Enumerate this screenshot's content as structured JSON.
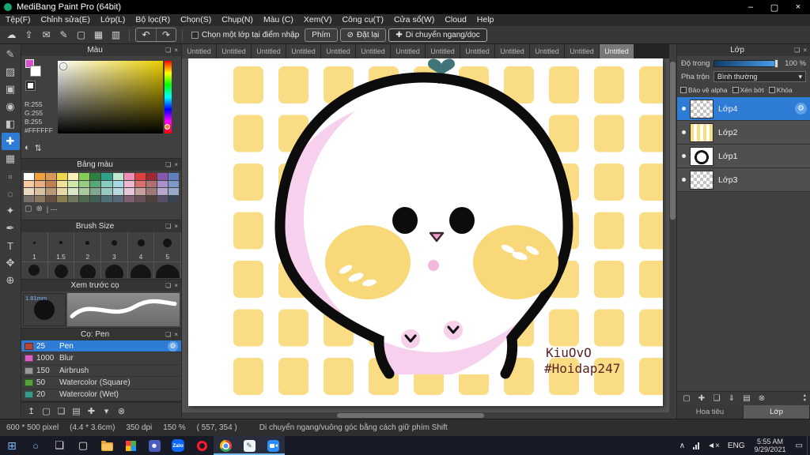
{
  "colors": {
    "accent_blue": "#2e7cd6",
    "canvas_yellow": "#f9dc83",
    "body_pink": "#f6d0ec",
    "sprout_teal": "#3f7478",
    "signature_red": "#5b2222"
  },
  "titlebar": {
    "title": "MediBang Paint Pro (64bit)",
    "minimize_glyph": "–",
    "maximize_glyph": "▢",
    "close_glyph": "×"
  },
  "menubar": {
    "items": [
      "Tệp(F)",
      "Chỉnh sửa(E)",
      "Lớp(L)",
      "Bộ lọc(R)",
      "Chọn(S)",
      "Chụp(N)",
      "Màu (C)",
      "Xem(V)",
      "Công cụ(T)",
      "Cửa sổ(W)",
      "Cloud",
      "Help"
    ]
  },
  "toolbar": {
    "icons": {
      "cloud": "☁",
      "upload": "⇧",
      "comment": "✉",
      "edit": "✎",
      "document": "▢",
      "grid": "▦",
      "table": "▥",
      "undo": "↶",
      "redo": "↷",
      "reset": "⊘",
      "move": "✚"
    },
    "select_layer_label": "Chọn một lớp tại điểm nhập",
    "key_button": "Phím",
    "reset_button": "Đặt lại",
    "move_button": "Di chuyển ngang/dọc"
  },
  "tabs": [
    {
      "label": "Untitled"
    },
    {
      "label": "Untitled"
    },
    {
      "label": "Untitled"
    },
    {
      "label": "Untitled"
    },
    {
      "label": "Untitled"
    },
    {
      "label": "Untitled"
    },
    {
      "label": "Untitled"
    },
    {
      "label": "Untitled"
    },
    {
      "label": "Untitled"
    },
    {
      "label": "Untitled"
    },
    {
      "label": "Untitled"
    },
    {
      "label": "Untitled"
    },
    {
      "label": "Untitled",
      "active": true
    }
  ],
  "tools": [
    {
      "glyph": "✎"
    },
    {
      "glyph": "▨"
    },
    {
      "glyph": "▣"
    },
    {
      "glyph": "◉"
    },
    {
      "glyph": "◧"
    },
    {
      "glyph": "✚",
      "active": true
    },
    {
      "glyph": "▦"
    },
    {
      "glyph": "▫"
    },
    {
      "glyph": "◌"
    },
    {
      "glyph": "✦"
    },
    {
      "glyph": "✒"
    },
    {
      "glyph": "T"
    },
    {
      "glyph": "✥"
    },
    {
      "glyph": "⊕"
    }
  ],
  "panel_icons": {
    "dock": "❏",
    "close": "×"
  },
  "color_panel": {
    "title": "Màu",
    "r": "R:255",
    "g": "G:255",
    "b": "B:255",
    "hex": "#FFFFFF",
    "footer_icons": [
      "◐",
      "⇅"
    ]
  },
  "palette_panel": {
    "title": "Bảng màu",
    "footer_icons": [
      "▢",
      "⊗"
    ],
    "divider_text": "| ---",
    "colors": [
      "#ffffff",
      "#f0a03c",
      "#d89858",
      "#f0d84a",
      "#f8f0b8",
      "#88cc58",
      "#2f8040",
      "#30a08c",
      "#c0e8cc",
      "#f090b8",
      "#e04040",
      "#a02830",
      "#8858b0",
      "#6080c0",
      "#f8c8a0",
      "#e8b080",
      "#c08050",
      "#f0e098",
      "#d0e8a8",
      "#98cc80",
      "#58a878",
      "#88ccc0",
      "#a8d8e8",
      "#f0b8d0",
      "#d87070",
      "#b07070",
      "#a890cc",
      "#8098c8",
      "#e8d8c0",
      "#d8c0a0",
      "#b89878",
      "#e8d8a8",
      "#d8e8c8",
      "#a8c8a0",
      "#80a890",
      "#98c8c0",
      "#b8d8e0",
      "#e8c8d8",
      "#c8a0a0",
      "#a07878",
      "#b8a8d0",
      "#98a8c8",
      "#787068",
      "#887860",
      "#685040",
      "#888050",
      "#707860",
      "#506850",
      "#406058",
      "#507078",
      "#586878",
      "#806070",
      "#685058",
      "#504040",
      "#585068",
      "#3a4450"
    ]
  },
  "brush_size_panel": {
    "title": "Brush Size",
    "sizes": [
      "1",
      "1.5",
      "2",
      "3",
      "4",
      "5"
    ]
  },
  "preview_panel": {
    "title": "Xem trước cọ",
    "size_label": "1.81mm"
  },
  "brush_panel": {
    "title": "Cọ: Pen",
    "gear_glyph": "⚙",
    "brushes": [
      {
        "size": "25",
        "name": "Pen",
        "chip": "#b5453a",
        "selected": true,
        "gear": true
      },
      {
        "size": "1000",
        "name": "Blur",
        "chip": "#d95fc3"
      },
      {
        "size": "150",
        "name": "Airbrush",
        "chip": "#9a9a9a"
      },
      {
        "size": "50",
        "name": "Watercolor (Square)",
        "chip": "#55a23c"
      },
      {
        "size": "20",
        "name": "Watercolor (Wet)",
        "chip": "#3a9a8a"
      }
    ]
  },
  "left_footer_icons": [
    "↥",
    "▢",
    "❏",
    "▤",
    "✚",
    "▾",
    "⊗"
  ],
  "layers_panel": {
    "title": "Lớp",
    "opacity_label": "Độ trong",
    "opacity_value": "100 %",
    "blend_label": "Pha trộn",
    "blend_value": "Bình thường",
    "blend_arrow": "▾",
    "alpha_label": "Bảo vệ alpha",
    "clip_label": "Xén bớt",
    "lock_label": "Khóa",
    "gear_glyph": "⚙",
    "layers": [
      {
        "name": "Lớp4",
        "selected": true,
        "gear": true,
        "thumb": "checker"
      },
      {
        "name": "Lớp2",
        "thumb": "plaid"
      },
      {
        "name": "Lớp1",
        "thumb": "blob"
      },
      {
        "name": "Lớp3",
        "thumb": "checker"
      }
    ],
    "footer_icons": [
      "▢",
      "✚",
      "❏",
      "⇓",
      "▤",
      "⊗"
    ],
    "up_glyph": "▲",
    "down_glyph": "▼",
    "nav_tab": "Hoa tiêu",
    "layer_tab": "Lớp"
  },
  "canvas": {
    "signature_line1": "KiuOvO",
    "signature_line2": "#Hoidap247"
  },
  "statusbar": {
    "size": "600 * 500 pixel",
    "cm": "(4.4 * 3.6cm)",
    "dpi": "350 dpi",
    "zoom": "150 %",
    "coords": "( 557, 354 )",
    "hint": "Di chuyển ngang/vuông góc bằng cách giữ phím Shift"
  },
  "taskbar": {
    "start_glyph": "⊞",
    "search_glyph": "○",
    "taskview_glyph": "❏",
    "monitor_glyph": "▢",
    "teams_glyph": "☻",
    "zalo_label": "Zalo",
    "medibang_glyph": "✎",
    "tray_chevron": "∧",
    "speaker_glyph": "◄×",
    "lang": "ENG",
    "time": "5:55 AM",
    "date": "9/29/2021",
    "notification_glyph": "▭"
  }
}
